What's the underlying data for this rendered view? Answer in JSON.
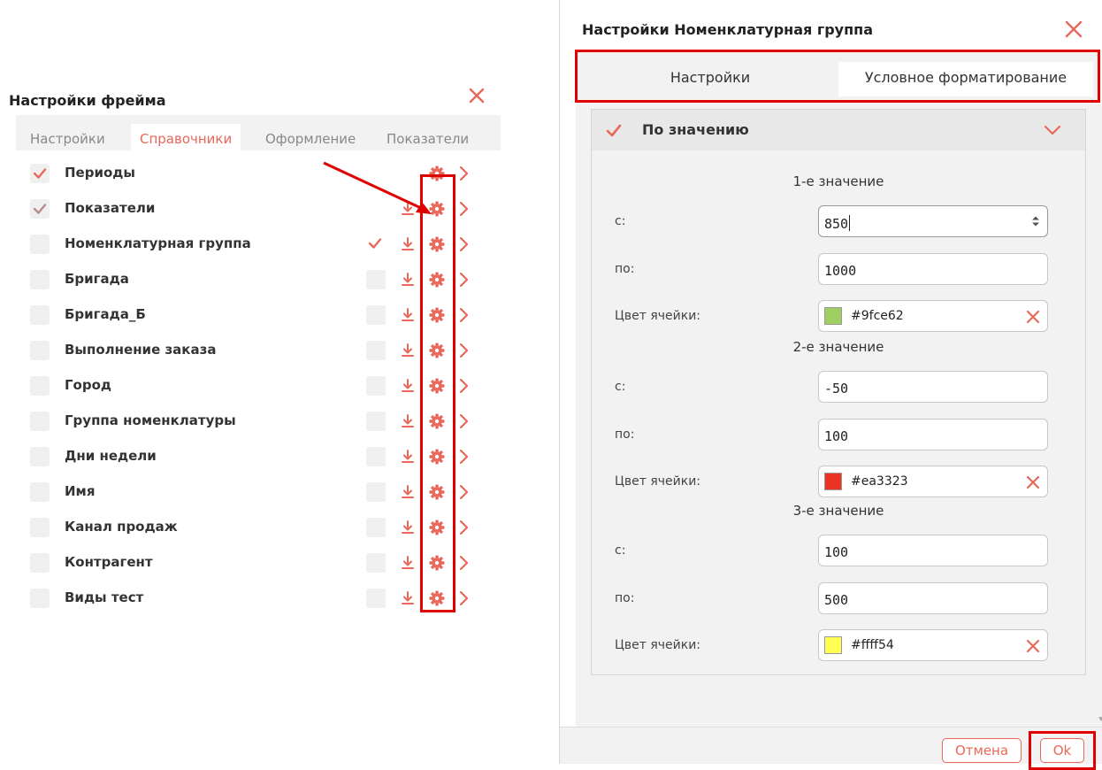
{
  "left_dialog": {
    "title": "Настройки фрейма",
    "tabs": [
      {
        "label": "Настройки",
        "active": false
      },
      {
        "label": "Справочники",
        "active": true
      },
      {
        "label": "Оформление",
        "active": false
      },
      {
        "label": "Показатели",
        "active": false
      }
    ],
    "items": [
      {
        "label": "Периоды",
        "checked": true,
        "sub_checked": null,
        "download": false
      },
      {
        "label": "Показатели",
        "checked": true,
        "sub_checked": null,
        "download": true
      },
      {
        "label": "Номенклатурная группа",
        "checked": false,
        "sub_checked": true,
        "download": true
      },
      {
        "label": "Бригада",
        "checked": false,
        "sub_checked": false,
        "download": true
      },
      {
        "label": "Бригада_Б",
        "checked": false,
        "sub_checked": false,
        "download": true
      },
      {
        "label": "Выполнение заказа",
        "checked": false,
        "sub_checked": false,
        "download": true
      },
      {
        "label": "Город",
        "checked": false,
        "sub_checked": false,
        "download": true
      },
      {
        "label": "Группа номенклатуры",
        "checked": false,
        "sub_checked": false,
        "download": true
      },
      {
        "label": "Дни недели",
        "checked": false,
        "sub_checked": false,
        "download": true
      },
      {
        "label": "Имя",
        "checked": false,
        "sub_checked": false,
        "download": true
      },
      {
        "label": "Канал продаж",
        "checked": false,
        "sub_checked": false,
        "download": true
      },
      {
        "label": "Контрагент",
        "checked": false,
        "sub_checked": false,
        "download": true
      },
      {
        "label": "Виды тест",
        "checked": false,
        "sub_checked": false,
        "download": true
      }
    ],
    "icons": {
      "close": "close-icon",
      "check": "check-icon",
      "download": "download-icon",
      "gear": "gear-icon",
      "chevron": "chevron-right-icon"
    }
  },
  "right_dialog": {
    "title": "Настройки Номенклатурная группа",
    "tabs": {
      "settings": "Настройки",
      "conditional": "Условное форматирование"
    },
    "panel": {
      "title": "По значению",
      "groups": [
        {
          "title": "1-е значение",
          "from_label": "с:",
          "from_value": "850",
          "to_label": "по:",
          "to_value": "1000",
          "color_label": "Цвет ячейки:",
          "color": "#9fce62"
        },
        {
          "title": "2-е значение",
          "from_label": "с:",
          "from_value": "-50",
          "to_label": "по:",
          "to_value": "100",
          "color_label": "Цвет ячейки:",
          "color": "#ea3323"
        },
        {
          "title": "3-е значение",
          "from_label": "с:",
          "from_value": "100",
          "to_label": "по:",
          "to_value": "500",
          "color_label": "Цвет ячейки:",
          "color": "#ffff54"
        }
      ]
    },
    "buttons": {
      "cancel": "Отмена",
      "ok": "Ok"
    }
  },
  "colors": {
    "accent": "#e8685a",
    "highlight": "#e00000"
  }
}
